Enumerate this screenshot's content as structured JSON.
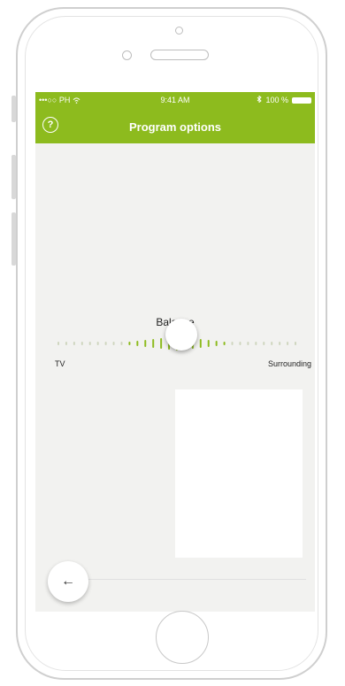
{
  "status_bar": {
    "carrier": "•••○○ PH",
    "wifi_icon": "wifi-icon",
    "time": "9:41 AM",
    "bluetooth_icon": "bluetooth-icon",
    "battery_text": "100 %"
  },
  "header": {
    "help_symbol": "?",
    "title": "Program options"
  },
  "balance": {
    "label": "Balance",
    "left_label": "TV",
    "right_label": "Surrounding",
    "value": 0.5,
    "accent_color": "#8dbb1e"
  },
  "footer": {
    "back_symbol": "←"
  },
  "colors": {
    "brand_green": "#8dbb1e",
    "screen_background": "#f2f2f0"
  }
}
